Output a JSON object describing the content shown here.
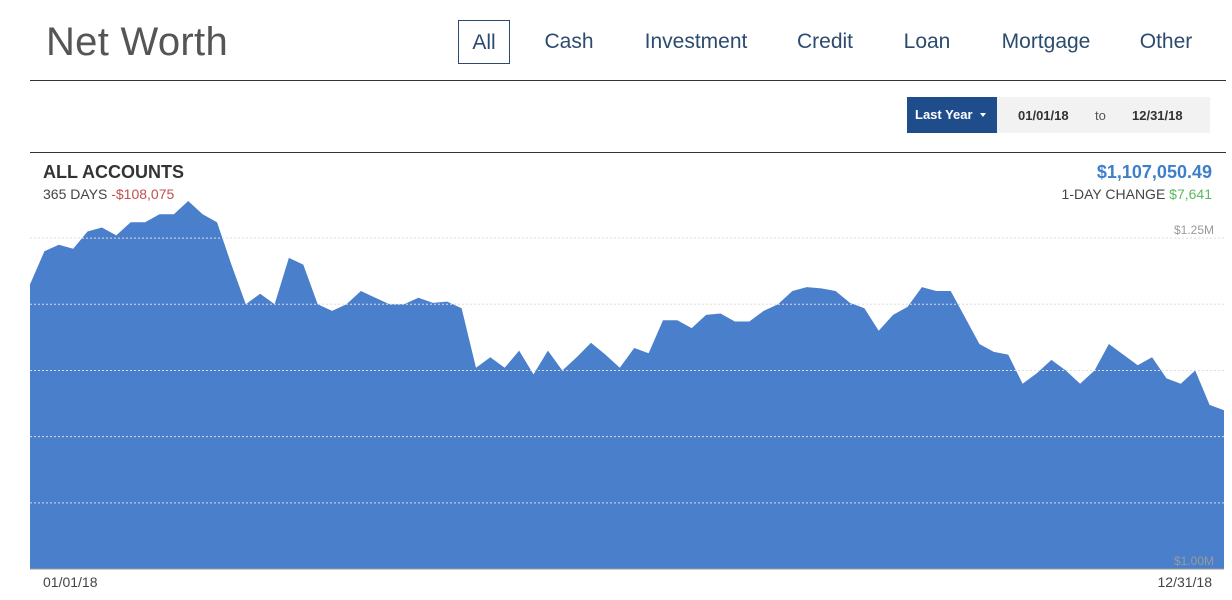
{
  "header": {
    "title": "Net Worth",
    "tabs": [
      "All",
      "Cash",
      "Investment",
      "Credit",
      "Loan",
      "Mortgage",
      "Other"
    ],
    "active_tab": "All"
  },
  "date_range": {
    "preset_label": "Last Year",
    "from": "01/01/18",
    "to_label": "to",
    "to": "12/31/18"
  },
  "summary": {
    "title": "ALL ACCOUNTS",
    "period_label": "365 DAYS",
    "period_change": "-$108,075",
    "total": "$1,107,050.49",
    "day_change_label": "1-DAY CHANGE",
    "day_change": "$7,641"
  },
  "colors": {
    "area_fill": "#4a7fcb",
    "primary_button": "#1f4d8c",
    "negative": "#c0504d",
    "positive": "#5cb85c",
    "total": "#3d7fc9"
  },
  "chart_data": {
    "type": "area",
    "x_start": "01/01/18",
    "x_end": "12/31/18",
    "ylim": [
      1000000,
      1275000
    ],
    "y_ticks": [
      1000000,
      1050000,
      1100000,
      1150000,
      1200000,
      1250000
    ],
    "y_tick_labels": {
      "1000000": "$1.00M",
      "1250000": "$1.25M"
    },
    "grid": true,
    "series": [
      {
        "values": [
          1215000,
          1240000,
          1245000,
          1242000,
          1255000,
          1258000,
          1252000,
          1262000,
          1262000,
          1268000,
          1268000,
          1278000,
          1268000,
          1262000,
          1230000,
          1200000,
          1208000,
          1200000,
          1235000,
          1230000,
          1200000,
          1195000,
          1200000,
          1210000,
          1205000,
          1200000,
          1200000,
          1205000,
          1201000,
          1202000,
          1197000,
          1152000,
          1160000,
          1152000,
          1165000,
          1147000,
          1165000,
          1150000,
          1160000,
          1171000,
          1162000,
          1152000,
          1167000,
          1163000,
          1188000,
          1188000,
          1182000,
          1192000,
          1193000,
          1187000,
          1187000,
          1195000,
          1200000,
          1210000,
          1213000,
          1212000,
          1210000,
          1201000,
          1197000,
          1180000,
          1192000,
          1198000,
          1213000,
          1210000,
          1210000,
          1190000,
          1170000,
          1164000,
          1162000,
          1140000,
          1148000,
          1158000,
          1150000,
          1140000,
          1150000,
          1170000,
          1162000,
          1154000,
          1160000,
          1144000,
          1140000,
          1150000,
          1124000,
          1120000
        ]
      }
    ]
  }
}
